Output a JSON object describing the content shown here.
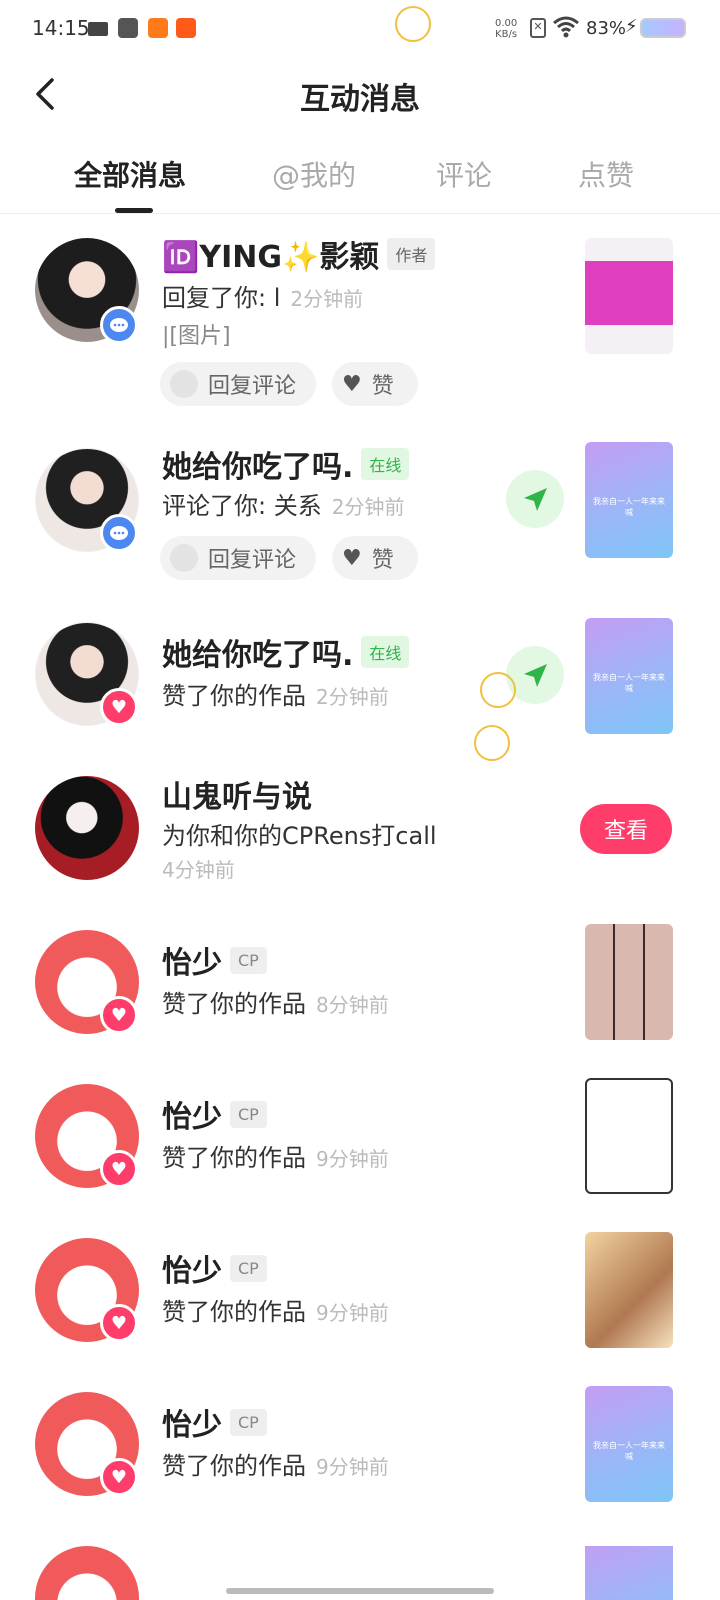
{
  "status_bar": {
    "time": "14:15",
    "net_speed": "0.00",
    "net_unit": "KB/s",
    "battery": "83%"
  },
  "header": {
    "title": "互动消息"
  },
  "tabs": [
    "全部消息",
    "@我的",
    "评论",
    "点赞"
  ],
  "messages": [
    {
      "name": "🆔YING✨影颖",
      "tag": "作者",
      "text": "回复了你: l",
      "time": "2分钟前",
      "sub": "|[图片]",
      "reply_label": "回复评论",
      "like_label": "赞"
    },
    {
      "name": "她给你吃了吗.",
      "tag": "在线",
      "text": "评论了你: 关系",
      "time": "2分钟前",
      "reply_label": "回复评论",
      "like_label": "赞",
      "thumb_text": "我亲自一人一年来来喊"
    },
    {
      "name": "她给你吃了吗.",
      "tag": "在线",
      "text": "赞了你的作品",
      "time": "2分钟前",
      "thumb_text": "我亲自一人一年来来喊"
    },
    {
      "name": "山鬼听与说",
      "text": "为你和你的CPRens打call",
      "time": "4分钟前",
      "button": "查看"
    },
    {
      "name": "怡少",
      "tag": "CP",
      "text": "赞了你的作品",
      "time": "8分钟前"
    },
    {
      "name": "怡少",
      "tag": "CP",
      "text": "赞了你的作品",
      "time": "9分钟前"
    },
    {
      "name": "怡少",
      "tag": "CP",
      "text": "赞了你的作品",
      "time": "9分钟前"
    },
    {
      "name": "怡少",
      "tag": "CP",
      "text": "赞了你的作品",
      "time": "9分钟前",
      "thumb_text": "我亲自一人一年来来喊"
    }
  ]
}
